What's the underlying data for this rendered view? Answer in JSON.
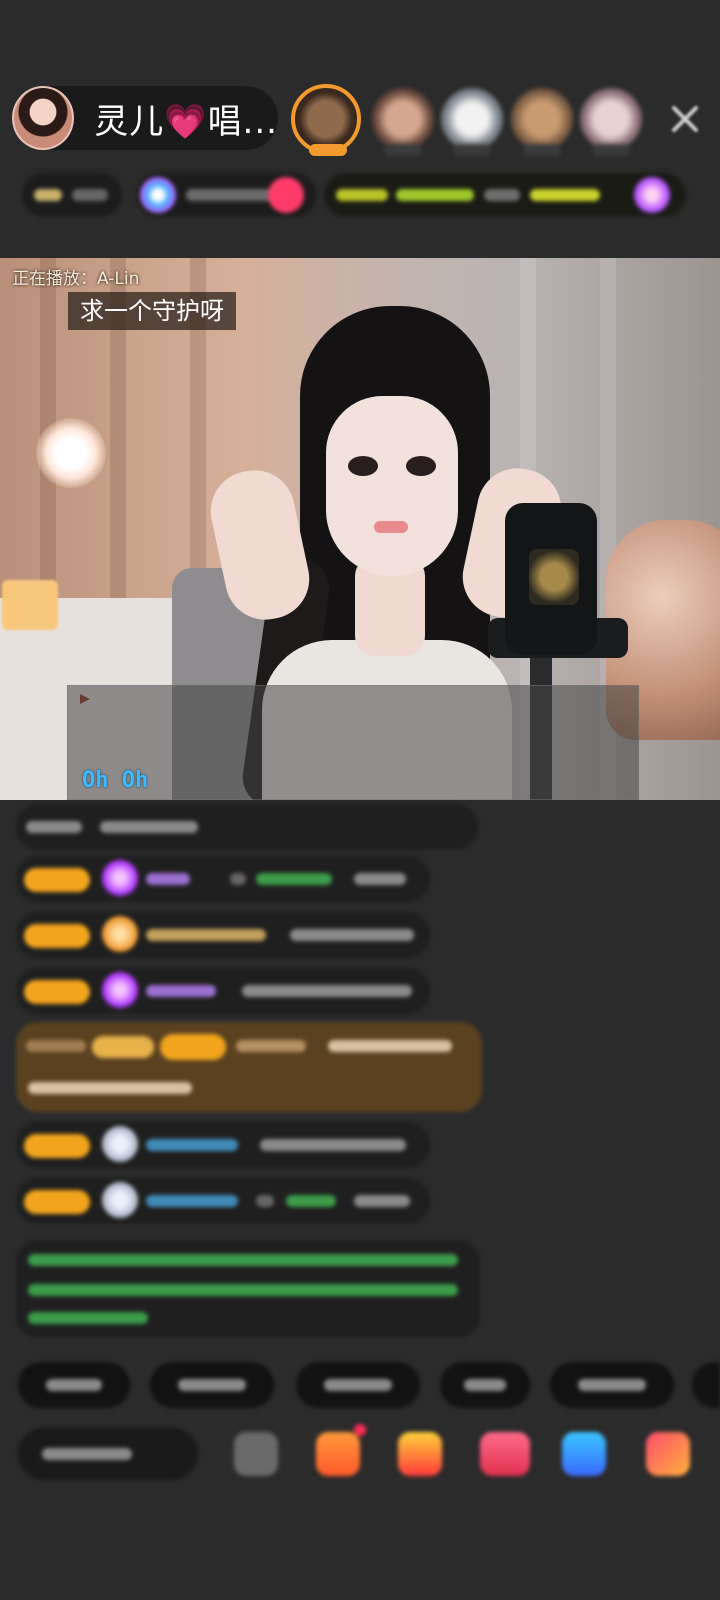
{
  "header": {
    "host_name": "灵儿",
    "host_heart": "💗",
    "host_name_suffix": "唱...",
    "viewers": [
      "avatar-1",
      "avatar-2",
      "avatar-3",
      "avatar-4",
      "avatar-5"
    ],
    "close_icon": "close-icon"
  },
  "video": {
    "now_playing": "正在播放：A-Lin",
    "guard_request": "求一个守护呀",
    "lyrics_line": "Oh  Oh"
  },
  "colors": {
    "background": "#2b2b2b",
    "gold_badge": "#f2a51c",
    "lyrics_blue": "#3fb9ff",
    "highlight_row": "#5a4120",
    "accent_pink": "#ff3da8"
  }
}
